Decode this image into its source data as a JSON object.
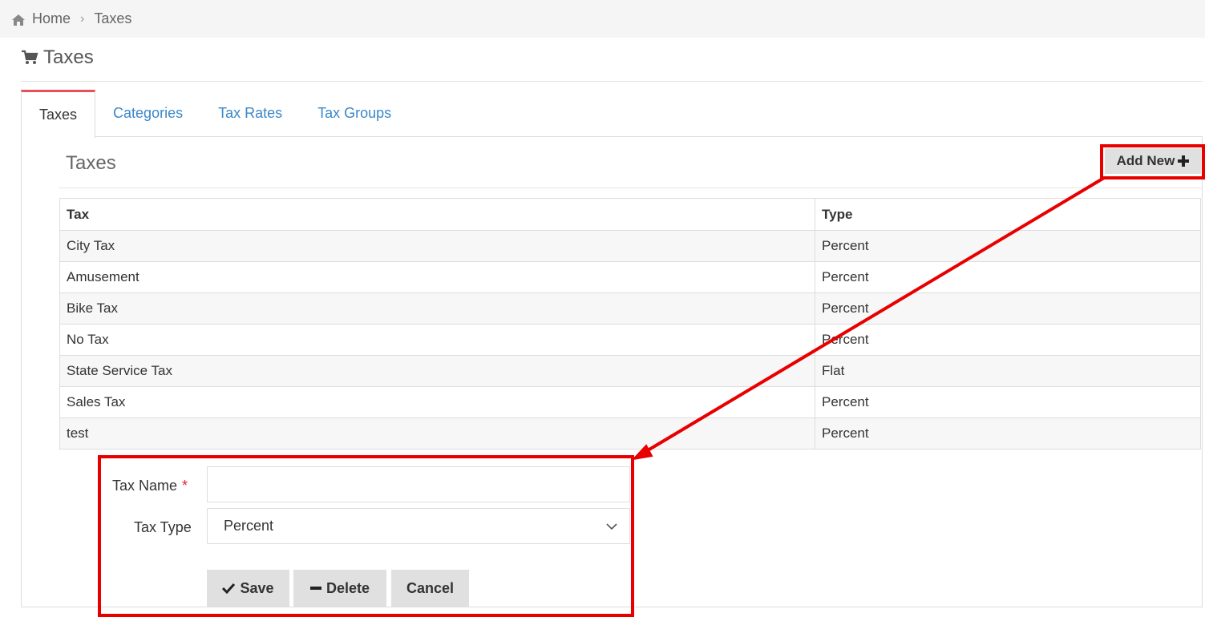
{
  "breadcrumb": {
    "home": "Home",
    "current": "Taxes"
  },
  "page": {
    "title": "Taxes"
  },
  "tabs": [
    {
      "label": "Taxes",
      "active": true
    },
    {
      "label": "Categories",
      "active": false
    },
    {
      "label": "Tax Rates",
      "active": false
    },
    {
      "label": "Tax Groups",
      "active": false
    }
  ],
  "section": {
    "title": "Taxes",
    "add_new_label": "Add New"
  },
  "table": {
    "headers": [
      "Tax",
      "Type"
    ],
    "rows": [
      [
        "City Tax",
        "Percent"
      ],
      [
        "Amusement",
        "Percent"
      ],
      [
        "Bike Tax",
        "Percent"
      ],
      [
        "No Tax",
        "Percent"
      ],
      [
        "State Service Tax",
        "Flat"
      ],
      [
        "Sales Tax",
        "Percent"
      ],
      [
        "test",
        "Percent"
      ]
    ]
  },
  "form": {
    "tax_name_label": "Tax Name",
    "required_mark": "*",
    "tax_name_value": "",
    "tax_type_label": "Tax Type",
    "tax_type_value": "Percent",
    "save_label": "Save",
    "delete_label": "Delete",
    "cancel_label": "Cancel"
  },
  "annotation": {
    "color": "#e80000"
  },
  "colors": {
    "tab_accent": "#e8505b",
    "link": "#3a87c8",
    "required": "#d9252b"
  }
}
